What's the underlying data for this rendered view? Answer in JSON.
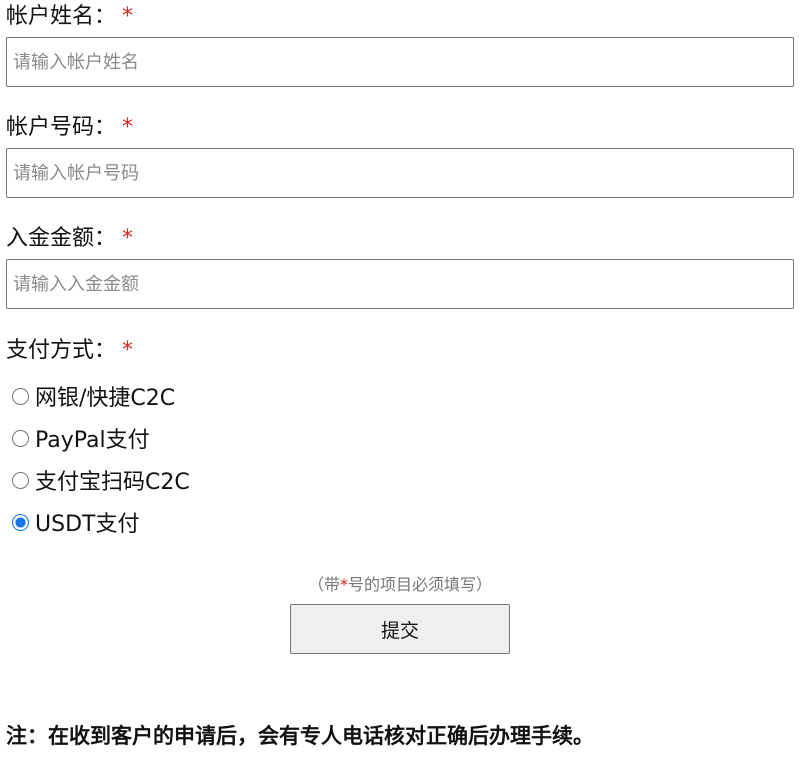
{
  "account_name": {
    "label": "帐户姓名：",
    "required_mark": "*",
    "placeholder": "请输入帐户姓名",
    "value": ""
  },
  "account_number": {
    "label": "帐户号码：",
    "required_mark": "*",
    "placeholder": "请输入帐户号码",
    "value": ""
  },
  "deposit_amount": {
    "label": "入金金额：",
    "required_mark": "*",
    "placeholder": "请输入入金金额",
    "value": ""
  },
  "payment_method": {
    "label": "支付方式：",
    "required_mark": "*",
    "options": [
      {
        "label": "网银/快捷C2C",
        "checked": false
      },
      {
        "label": "PayPal支付",
        "checked": false
      },
      {
        "label": "支付宝扫码C2C",
        "checked": false
      },
      {
        "label": "USDT支付",
        "checked": true
      }
    ]
  },
  "hint": {
    "prefix": "（带",
    "star": "*",
    "suffix": "号的项目必须填写）"
  },
  "submit_label": "提交",
  "note": "注：在收到客户的申请后，会有专人电话核对正确后办理手续。",
  "colors": {
    "required": "#e02020",
    "radio_accent": "#1a73e8"
  }
}
